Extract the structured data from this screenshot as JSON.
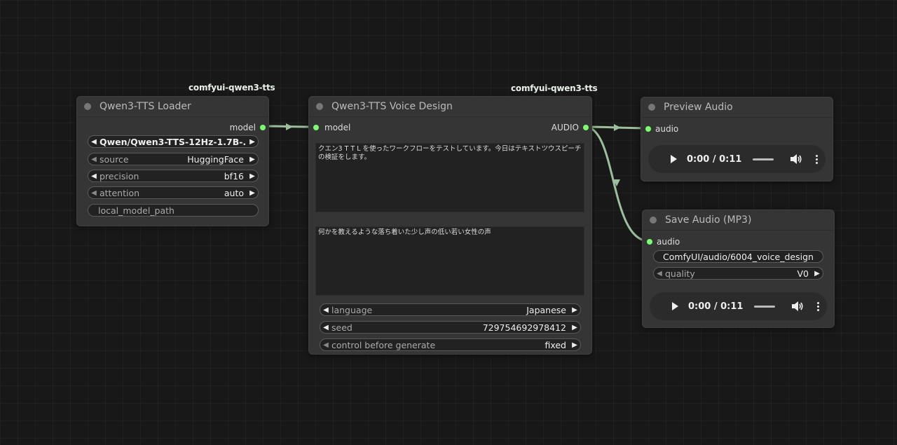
{
  "badges": {
    "loader": "comfyui-qwen3-tts",
    "voice_design": "comfyui-qwen3-tts"
  },
  "loader": {
    "title": "Qwen3-TTS Loader",
    "output_label": "model",
    "model_value": "Qwen/Qwen3-TTS-12Hz-1.7B-...",
    "source_label": "source",
    "source_value": "HuggingFace",
    "precision_label": "precision",
    "precision_value": "bf16",
    "attention_label": "attention",
    "attention_value": "auto",
    "local_model_path": "local_model_path"
  },
  "voice_design": {
    "title": "Qwen3-TTS Voice Design",
    "input_label": "model",
    "output_label": "AUDIO",
    "text": "クエン3 T T L を使ったワークフローをテストしています。今日はテキストツウスピーチの検証をします。",
    "instruct": "何かを教えるような落ち着いた少し声の低い若い女性の声",
    "language_label": "language",
    "language_value": "Japanese",
    "seed_label": "seed",
    "seed_value": "729754692978412",
    "control_label": "control before generate",
    "control_value": "fixed"
  },
  "preview": {
    "title": "Preview Audio",
    "input_label": "audio",
    "time": "0:00 / 0:11",
    "progress": 0.0
  },
  "save": {
    "title": "Save Audio (MP3)",
    "input_label": "audio",
    "filename_prefix": "ComfyUI/audio/6004_voice_design",
    "quality_label": "quality",
    "quality_value": "V0",
    "time": "0:00 / 0:11",
    "progress": 0.0
  },
  "colors": {
    "port": "#7cff6e",
    "wire": "#9bbf9b"
  },
  "icons": [
    "play-icon",
    "volume-icon",
    "more-vert-icon",
    "arrow-left-icon",
    "arrow-right-icon"
  ]
}
